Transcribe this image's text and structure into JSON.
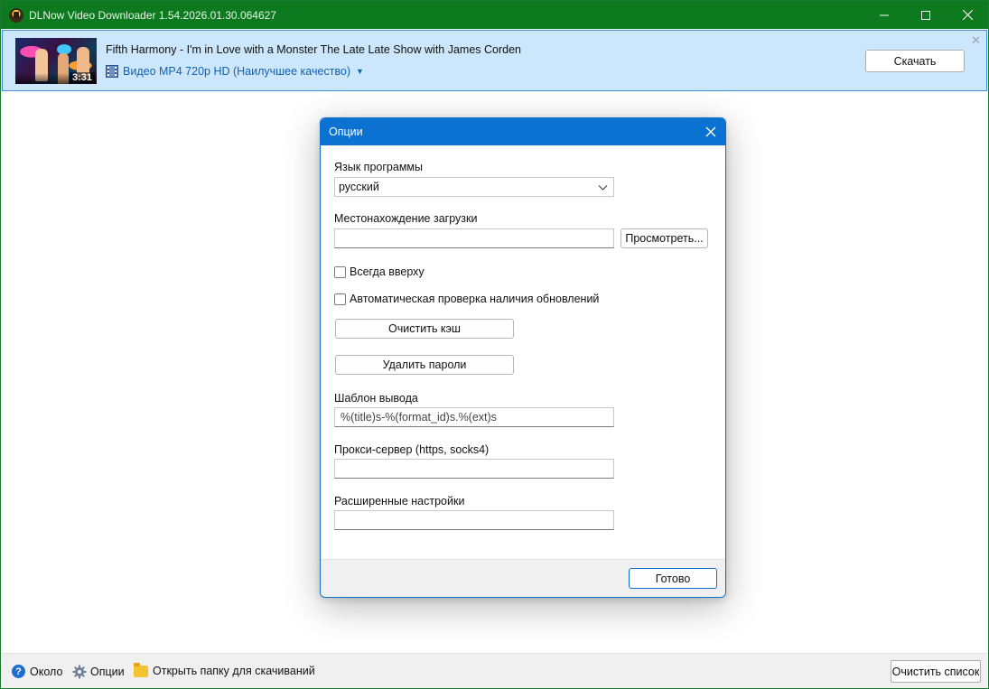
{
  "window": {
    "title": "DLNow Video Downloader 1.54.2026.01.30.064627",
    "controls": {
      "minimize": "—",
      "maximize": "☐",
      "close": "✕"
    }
  },
  "infobar": {
    "thumbnail_duration": "3:31",
    "video_title": "Fifth Harmony - I'm in Love with a Monster The Late Late Show with James Corden",
    "format_label": "Видео MP4 720p HD (Наилучшее качество)",
    "download_button": "Скачать",
    "close_glyph": "✕"
  },
  "dialog": {
    "title": "Опции",
    "language_label": "Язык программы",
    "language_value": "русский",
    "download_location_label": "Местонахождение загрузки",
    "download_location_value": "",
    "browse_button": "Просмотреть...",
    "always_on_top_label": "Всегда вверху",
    "auto_update_label": "Автоматическая проверка наличия обновлений",
    "clear_cache_button": "Очистить кэш",
    "delete_passwords_button": "Удалить пароли",
    "output_template_label": "Шаблон вывода",
    "output_template_value": "%(title)s-%(format_id)s.%(ext)s",
    "proxy_label": "Прокси-сервер (https, socks4)",
    "proxy_value": "",
    "advanced_label": "Расширенные настройки",
    "advanced_value": "",
    "done_button": "Готово"
  },
  "statusbar": {
    "about": "Около",
    "options": "Опции",
    "open_folder": "Открыть папку для скачиваний",
    "clear_list_button": "Очистить список"
  },
  "colors": {
    "titlebar": "#0e7a1f",
    "infobar_bg": "#cce6fb",
    "dialog_titlebar": "#0b72d1",
    "link_blue": "#0f63b6"
  }
}
